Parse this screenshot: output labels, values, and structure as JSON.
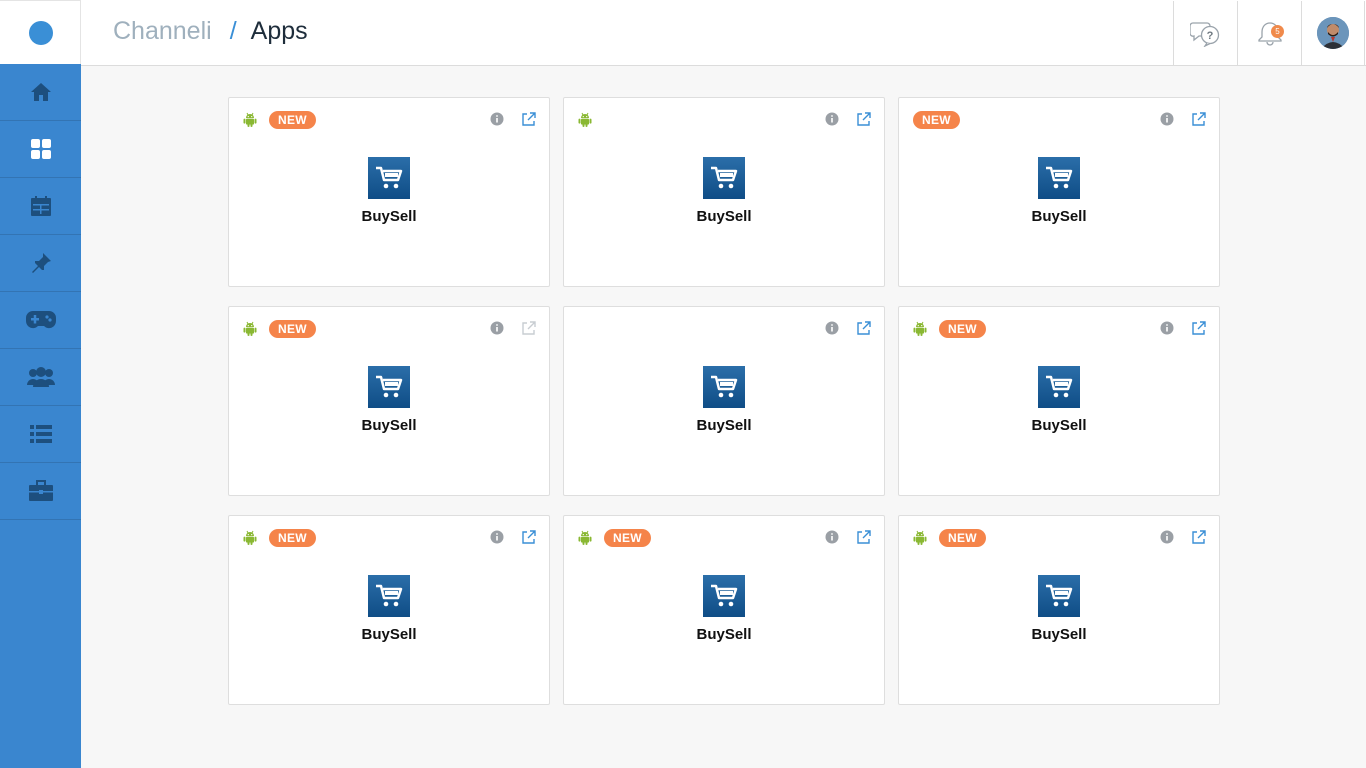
{
  "header": {
    "breadcrumb_root": "Channeli",
    "breadcrumb_separator": "/",
    "breadcrumb_current": "Apps",
    "notification_count": "5"
  },
  "sidebar": {
    "items": [
      {
        "icon": "home-icon"
      },
      {
        "icon": "apps-grid-icon"
      },
      {
        "icon": "calendar-icon"
      },
      {
        "icon": "pin-icon"
      },
      {
        "icon": "gamepad-icon"
      },
      {
        "icon": "people-icon"
      },
      {
        "icon": "list-icon"
      },
      {
        "icon": "briefcase-icon"
      }
    ]
  },
  "apps": [
    {
      "name": "BuySell",
      "android": true,
      "new": true,
      "new_label": "NEW",
      "external_link_enabled": true
    },
    {
      "name": "BuySell",
      "android": true,
      "new": false,
      "new_label": "",
      "external_link_enabled": true
    },
    {
      "name": "BuySell",
      "android": false,
      "new": true,
      "new_label": "NEW",
      "external_link_enabled": true
    },
    {
      "name": "BuySell",
      "android": true,
      "new": true,
      "new_label": "NEW",
      "external_link_enabled": false
    },
    {
      "name": "BuySell",
      "android": false,
      "new": false,
      "new_label": "",
      "external_link_enabled": true
    },
    {
      "name": "BuySell",
      "android": true,
      "new": true,
      "new_label": "NEW",
      "external_link_enabled": true
    },
    {
      "name": "BuySell",
      "android": true,
      "new": true,
      "new_label": "NEW",
      "external_link_enabled": true
    },
    {
      "name": "BuySell",
      "android": true,
      "new": true,
      "new_label": "NEW",
      "external_link_enabled": true
    },
    {
      "name": "BuySell",
      "android": true,
      "new": true,
      "new_label": "NEW",
      "external_link_enabled": true
    }
  ],
  "colors": {
    "sidebar": "#3a86cf",
    "accent": "#3a8fd6",
    "new_badge": "#f5844a",
    "android": "#8ab833",
    "app_icon": "#1b5c97"
  }
}
